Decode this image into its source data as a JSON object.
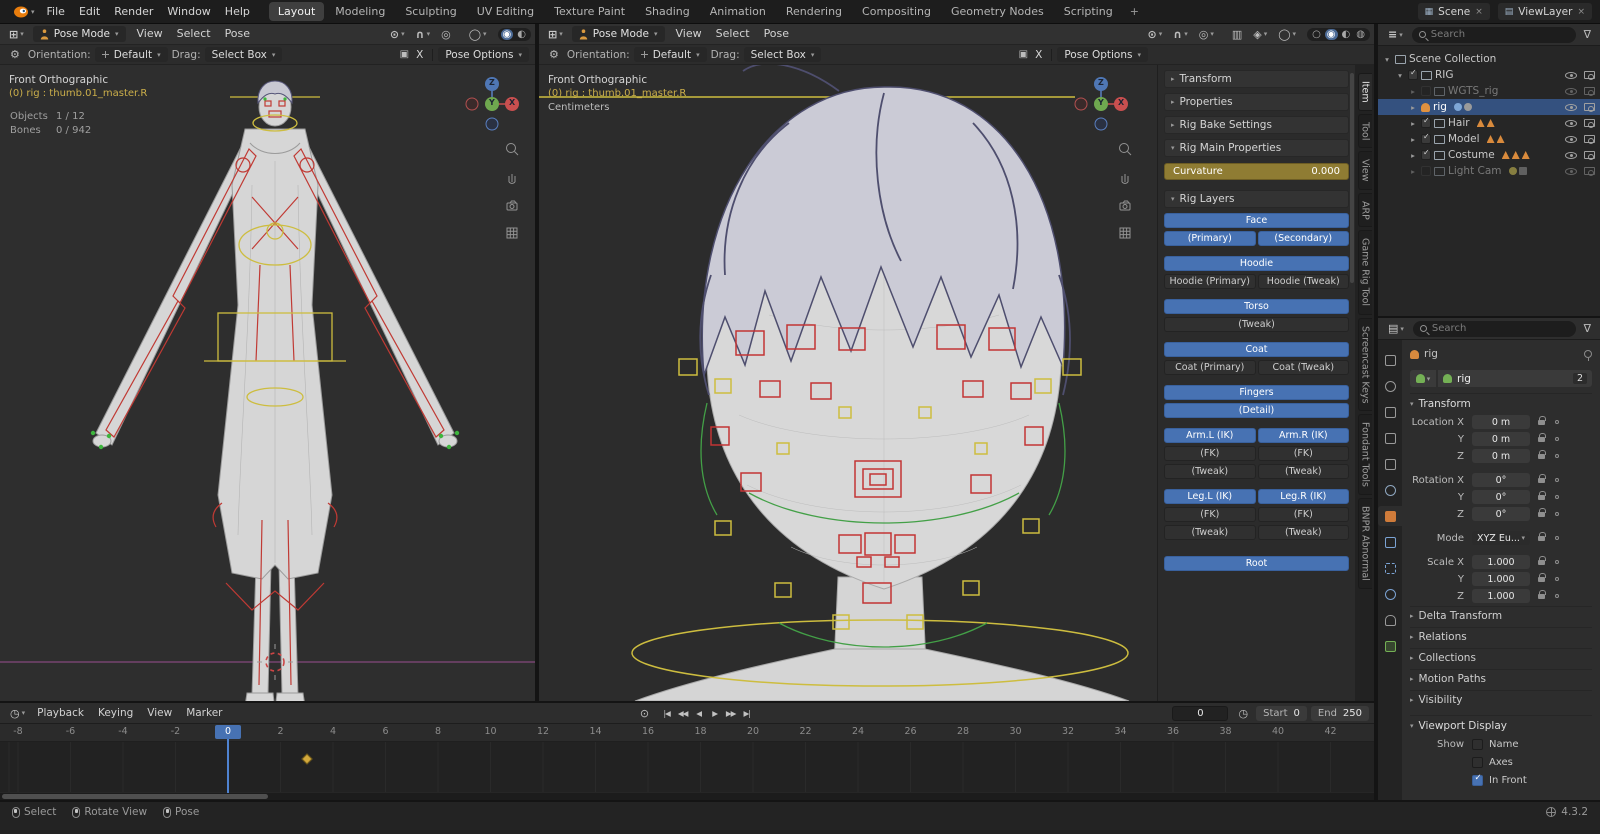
{
  "icons": {
    "dropdown": "▾",
    "collapsed": "▸",
    "expanded": "▾",
    "grid_editor": "⊞",
    "clock_editor": "◷",
    "outliner_editor": "≡",
    "properties_editor": "▤",
    "pivot": "⊙",
    "magnet": "∩",
    "proportional": "◎",
    "xray": "▥",
    "overlays": "◯",
    "gizmos": "◈",
    "wireframe": "○",
    "solid": "◉",
    "material": "◐",
    "rendered": "◍",
    "auto_key": "⊙",
    "filter": "∇",
    "settings": "⚙",
    "mirror": "▣"
  },
  "topbar": {
    "menus": [
      "File",
      "Edit",
      "Render",
      "Window",
      "Help"
    ],
    "workspaces": [
      {
        "label": "Layout",
        "active": true
      },
      {
        "label": "Modeling"
      },
      {
        "label": "Sculpting"
      },
      {
        "label": "UV Editing"
      },
      {
        "label": "Texture Paint"
      },
      {
        "label": "Shading"
      },
      {
        "label": "Animation"
      },
      {
        "label": "Rendering"
      },
      {
        "label": "Compositing"
      },
      {
        "label": "Geometry Nodes"
      },
      {
        "label": "Scripting"
      },
      {
        "label": "+",
        "add": true
      }
    ],
    "scene_label": "Scene",
    "viewlayer_label": "ViewLayer"
  },
  "viewport_left": {
    "mode": "Pose Mode",
    "menus": [
      "View",
      "Select",
      "Pose"
    ],
    "orientation_label": "Orientation:",
    "orientation_value": "Default",
    "drag_label": "Drag:",
    "drag_value": "Select Box",
    "mirror_label": "X",
    "pose_options_label": "Pose Options",
    "view_name": "Front Orthographic",
    "active_item": "(0) rig : thumb.01_master.R",
    "stats": {
      "objects_label": "Objects",
      "objects_value": "1 / 12",
      "bones_label": "Bones",
      "bones_value": "0 / 942"
    },
    "axis": {
      "x": "X",
      "y": "Y",
      "z": "Z"
    }
  },
  "viewport_center": {
    "mode": "Pose Mode",
    "menus": [
      "View",
      "Select",
      "Pose"
    ],
    "orientation_label": "Orientation:",
    "orientation_value": "Default",
    "drag_label": "Drag:",
    "drag_value": "Select Box",
    "mirror_label": "X",
    "pose_options_label": "Pose Options",
    "view_name": "Front Orthographic",
    "active_item": "(0) rig : thumb.01_master.R",
    "unit": "Centimeters",
    "axis": {
      "x": "X",
      "y": "Y",
      "z": "Z"
    }
  },
  "sidebar": {
    "tabs": [
      {
        "label": "Item",
        "active": true
      },
      {
        "label": "Tool"
      },
      {
        "label": "View"
      },
      {
        "label": "ARP"
      },
      {
        "label": "Game Rig Tool"
      },
      {
        "label": "Screencast Keys"
      },
      {
        "label": "Fondant Tools"
      },
      {
        "label": "BNPR Abnormal"
      }
    ],
    "panels_collapsed": [
      {
        "label": "Transform"
      },
      {
        "label": "Properties"
      },
      {
        "label": "Rig Bake Settings"
      }
    ],
    "rig_main": {
      "title": "Rig Main Properties",
      "slider_label": "Curvature",
      "slider_value": "0.000"
    },
    "rig_layers": {
      "title": "Rig Layers",
      "rows": [
        {
          "buttons": [
            {
              "label": "Face",
              "blue": true
            }
          ]
        },
        {
          "buttons": [
            {
              "label": "(Primary)",
              "blue": true
            },
            {
              "label": "(Secondary)",
              "blue": true
            }
          ]
        },
        {
          "gap": true,
          "buttons": [
            {
              "label": "Hoodie",
              "blue": true
            }
          ]
        },
        {
          "buttons": [
            {
              "label": "Hoodie (Primary)"
            },
            {
              "label": "Hoodie (Tweak)"
            }
          ]
        },
        {
          "gap": true,
          "buttons": [
            {
              "label": "Torso",
              "blue": true
            }
          ]
        },
        {
          "buttons": [
            {
              "label": "(Tweak)"
            }
          ]
        },
        {
          "gap": true,
          "buttons": [
            {
              "label": "Coat",
              "blue": true
            }
          ]
        },
        {
          "buttons": [
            {
              "label": "Coat (Primary)"
            },
            {
              "label": "Coat (Tweak)"
            }
          ]
        },
        {
          "gap": true,
          "buttons": [
            {
              "label": "Fingers",
              "blue": true
            }
          ]
        },
        {
          "buttons": [
            {
              "label": "(Detail)",
              "blue": true
            }
          ]
        },
        {
          "gap": true,
          "buttons": [
            {
              "label": "Arm.L (IK)",
              "blue": true
            },
            {
              "label": "Arm.R (IK)",
              "blue": true
            }
          ]
        },
        {
          "buttons": [
            {
              "label": "(FK)"
            },
            {
              "label": "(FK)"
            }
          ]
        },
        {
          "buttons": [
            {
              "label": "(Tweak)"
            },
            {
              "label": "(Tweak)"
            }
          ]
        },
        {
          "gap": true,
          "buttons": [
            {
              "label": "Leg.L (IK)",
              "blue": true
            },
            {
              "label": "Leg.R (IK)",
              "blue": true
            }
          ]
        },
        {
          "buttons": [
            {
              "label": "(FK)"
            },
            {
              "label": "(FK)"
            }
          ]
        },
        {
          "buttons": [
            {
              "label": "(Tweak)"
            },
            {
              "label": "(Tweak)"
            }
          ]
        },
        {
          "gap2": true,
          "buttons": [
            {
              "label": "Root",
              "blue": true
            }
          ]
        }
      ]
    }
  },
  "outliner": {
    "search_placeholder": "Search",
    "rows": [
      {
        "label": "Scene Collection",
        "icon": "collection",
        "level": 0,
        "caret": "▾"
      },
      {
        "label": "RIG",
        "icon": "collection",
        "level": 1,
        "caret": "▾",
        "checkbox": "checked",
        "eye": true
      },
      {
        "label": "WGTS_rig",
        "icon": "collection",
        "level": 2,
        "caret": "▸",
        "checkbox": "unchecked",
        "dim": true,
        "eye": true
      },
      {
        "label": "rig",
        "icon": "armature",
        "level": 2,
        "caret": "▸",
        "selected": true,
        "badges": [
          "pose",
          "constraint"
        ],
        "eye": true
      },
      {
        "label": "Hair",
        "icon": "collection",
        "level": 2,
        "caret": "▸",
        "checkbox": "checked",
        "badges": [
          "mesh",
          "mesh"
        ],
        "eye": true
      },
      {
        "label": "Model",
        "icon": "collection",
        "level": 2,
        "caret": "▸",
        "checkbox": "checked",
        "badges": [
          "mesh",
          "mesh"
        ],
        "eye": true
      },
      {
        "label": "Costume",
        "icon": "collection",
        "level": 2,
        "caret": "▸",
        "checkbox": "checked",
        "badges": [
          "mesh",
          "mesh",
          "mesh"
        ],
        "eye": true
      },
      {
        "label": "Light Cam",
        "icon": "collection",
        "level": 2,
        "caret": "▸",
        "checkbox": "unchecked",
        "dim": true,
        "badges": [
          "light",
          "camera"
        ],
        "eye": true
      }
    ]
  },
  "properties": {
    "search_placeholder": "Search",
    "tabs": [
      {
        "name": "tool"
      },
      {
        "name": "render"
      },
      {
        "name": "output"
      },
      {
        "name": "view-layer"
      },
      {
        "name": "scene"
      },
      {
        "name": "world"
      },
      {
        "name": "object",
        "active": true
      },
      {
        "name": "modifiers"
      },
      {
        "name": "particles"
      },
      {
        "name": "physics"
      },
      {
        "name": "constraints"
      },
      {
        "name": "object-data"
      }
    ],
    "breadcrumb": "rig",
    "datablock": {
      "name": "rig",
      "users": "2"
    },
    "transform_title": "Transform",
    "fields": [
      {
        "label": "Location X",
        "value": "0 m"
      },
      {
        "label": "Y",
        "value": "0 m"
      },
      {
        "label": "Z",
        "value": "0 m"
      },
      {
        "label": "Rotation X",
        "value": "0°",
        "gap": true
      },
      {
        "label": "Y",
        "value": "0°"
      },
      {
        "label": "Z",
        "value": "0°"
      },
      {
        "label": "Mode",
        "value": "XYZ Eu...",
        "dropdown": true,
        "gap": true
      },
      {
        "label": "Scale X",
        "value": "1.000",
        "gap": true
      },
      {
        "label": "Y",
        "value": "1.000"
      },
      {
        "label": "Z",
        "value": "1.000"
      }
    ],
    "collapsed_panels": [
      {
        "label": "Delta Transform"
      },
      {
        "label": "Relations"
      },
      {
        "label": "Collections"
      },
      {
        "label": "Motion Paths"
      },
      {
        "label": "Visibility"
      }
    ],
    "viewport_display": {
      "title": "Viewport Display",
      "options": [
        {
          "row_label": "Show",
          "label": "Name"
        },
        {
          "label": "Axes"
        },
        {
          "label": "In Front",
          "checked": true
        }
      ]
    }
  },
  "timeline": {
    "menus": [
      "Playback",
      "Keying",
      "View",
      "Marker"
    ],
    "ticks": [
      -8,
      -6,
      -4,
      -2,
      0,
      2,
      4,
      6,
      8,
      10,
      12,
      14,
      16,
      18,
      20,
      22,
      24,
      26,
      28,
      30,
      32,
      34,
      36,
      38,
      40,
      42
    ],
    "transport": [
      {
        "name": "jump-to-start-button",
        "glyph": "|◀"
      },
      {
        "name": "jump-to-prev-keyframe-button",
        "glyph": "◀◀"
      },
      {
        "name": "play-reverse-button",
        "glyph": "◀"
      },
      {
        "name": "play-button",
        "glyph": "▶"
      },
      {
        "name": "jump-to-next-keyframe-button",
        "glyph": "▶▶"
      },
      {
        "name": "jump-to-end-button",
        "glyph": "▶|"
      }
    ],
    "current_frame": "0",
    "playhead_frame": 0,
    "keyframes": [
      3
    ],
    "start_label": "Start",
    "start_value": "0",
    "end_label": "End",
    "end_value": "250"
  },
  "statusbar": {
    "hints": [
      {
        "button": "left",
        "label": "Select"
      },
      {
        "button": "middle",
        "label": "Rotate View"
      },
      {
        "button": "right",
        "label": "Pose"
      }
    ],
    "version": "4.3.2"
  }
}
